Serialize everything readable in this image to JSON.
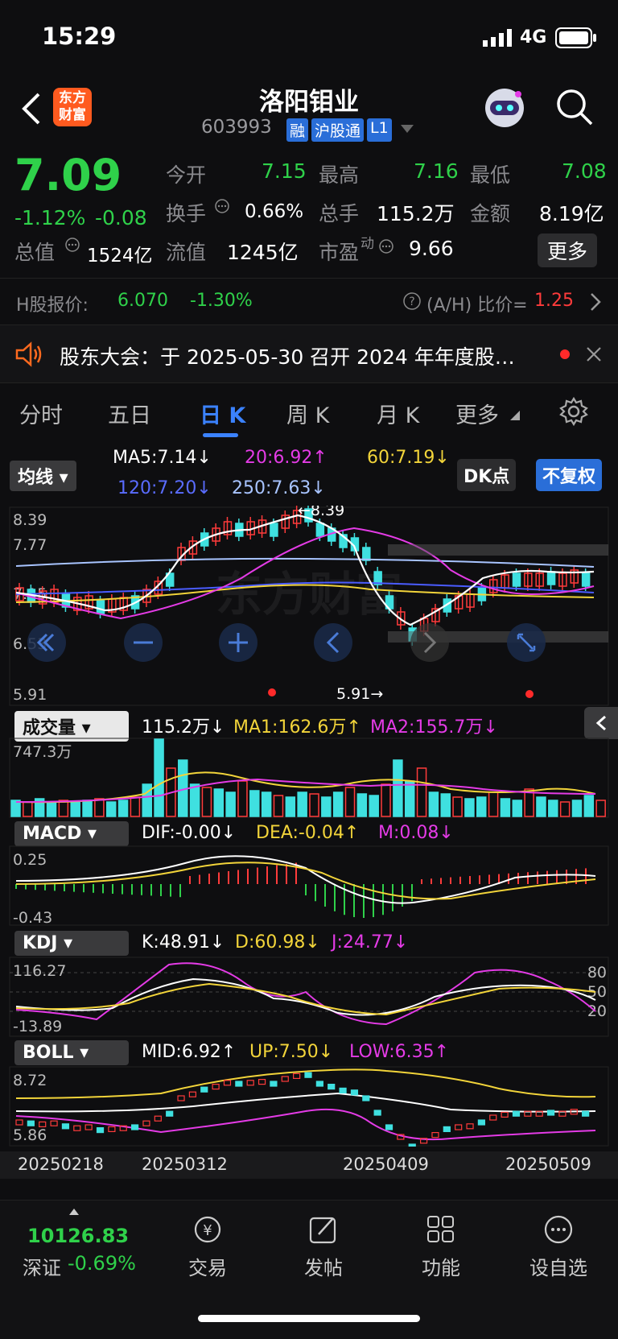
{
  "status_bar": {
    "time": "15:29",
    "network": "4G"
  },
  "nav": {
    "title": "洛阳钼业",
    "code": "603993",
    "badges": [
      "融",
      "沪股通",
      "L1"
    ],
    "logo_text": "东方\n财富"
  },
  "quote": {
    "price": "7.09",
    "change_pct": "-1.12%",
    "change": "-0.08",
    "open_label": "今开",
    "open": "7.15",
    "high_label": "最高",
    "high": "7.16",
    "low_label": "最低",
    "low": "7.08",
    "turnover_label": "换手",
    "turnover": "0.66%",
    "volume_label": "总手",
    "volume": "115.2万",
    "amount_label": "金额",
    "amount": "8.19亿",
    "mktcap_label": "总值",
    "mktcap": "1524亿",
    "float_label": "流值",
    "float": "1245亿",
    "pe_label": "市盈",
    "pe_sup": "动",
    "pe": "9.66",
    "more_button": "更多"
  },
  "h_share": {
    "label": "H股报价:",
    "price": "6.070",
    "change": "-1.30%",
    "ah_label": "(A/H) 比价=",
    "ah_value": "1.25"
  },
  "notice": {
    "text": "股东大会：于 2025-05-30 召开 2024 年年度股…"
  },
  "tabs": [
    {
      "label": "分时"
    },
    {
      "label": "五日"
    },
    {
      "label": "日 K",
      "active": true
    },
    {
      "label": "周 K"
    },
    {
      "label": "月 K"
    },
    {
      "label": "更多"
    }
  ],
  "kline": {
    "ma_selector": "均线",
    "dk_button": "DK点",
    "adjust_button": "不复权",
    "ma5": "MA5:7.14",
    "ma20": "20:6.92",
    "ma60": "60:7.19",
    "ma120": "120:7.20",
    "ma250": "250:7.63",
    "price_ticks": [
      "8.39",
      "7.77",
      "7.15",
      "6.53",
      "5.91"
    ],
    "high_marker": "8.39",
    "low_marker": "5.91",
    "watermark": "东方财富"
  },
  "volume": {
    "selector": "成交量",
    "value": "115.2万",
    "ma1": "MA1:162.6万",
    "ma2": "MA2:155.7万",
    "max_tick": "747.3万"
  },
  "macd": {
    "selector": "MACD",
    "dif": "DIF:-0.00",
    "dea": "DEA:-0.04",
    "m": "M:0.08",
    "ticks": [
      "0.25",
      "-0.43"
    ]
  },
  "kdj": {
    "selector": "KDJ",
    "k": "K:48.91",
    "d": "D:60.98",
    "j": "J:24.77",
    "ticks": [
      "116.27",
      "-13.89"
    ],
    "right_ticks": [
      "80",
      "50",
      "20"
    ]
  },
  "boll": {
    "selector": "BOLL",
    "mid": "MID:6.92",
    "up": "UP:7.50",
    "low": "LOW:6.35",
    "ticks": [
      "8.72",
      "5.86"
    ]
  },
  "dates": [
    "20250218",
    "20250312",
    "20250409",
    "20250509"
  ],
  "bottom": {
    "index_value": "10126.83",
    "index_name": "深证",
    "index_change": "-0.69%",
    "trade": "交易",
    "post": "发帖",
    "features": "功能",
    "watchlist": "设自选"
  },
  "colors": {
    "up": "#ff3b3b",
    "down": "#2fd14a",
    "candle_down": "#3fe0e0",
    "ma5": "#ffffff",
    "ma20": "#e43be6",
    "ma60": "#f2d43a",
    "ma120": "#4a5cff",
    "ma250": "#a8c4ff",
    "accent": "#2a6ed8"
  },
  "icons": [
    "back-icon",
    "search-icon",
    "robot-icon",
    "speaker-icon",
    "close-icon",
    "gear-icon",
    "chevron-right-icon",
    "question-icon",
    "info-icon",
    "left-arrow-icon"
  ]
}
